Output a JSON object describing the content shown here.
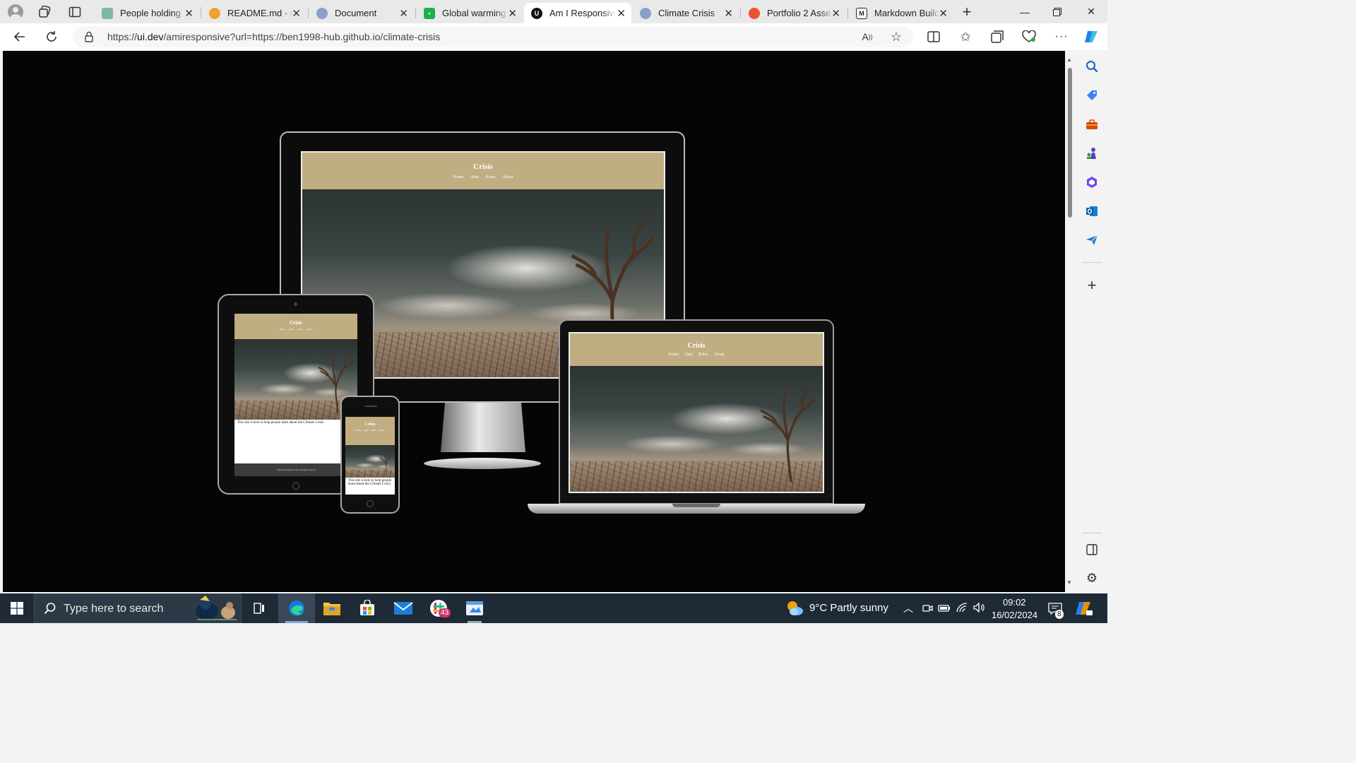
{
  "browser": {
    "tabs": [
      {
        "title": "People holding",
        "favicon_color": "#7fb7a3",
        "active": false
      },
      {
        "title": "README.md - c",
        "favicon_color": "#f0a030",
        "active": false
      },
      {
        "title": "Document",
        "favicon_color": "#8aa0c8",
        "active": false
      },
      {
        "title": "Global warming",
        "favicon_color": "#1fae4b",
        "active": false
      },
      {
        "title": "Am I Responsive",
        "favicon_color": "#111111",
        "active": true
      },
      {
        "title": "Climate Crisis",
        "favicon_color": "#8aa0c8",
        "active": false
      },
      {
        "title": "Portfolio 2 Asse",
        "favicon_color": "#e8542f",
        "active": false
      },
      {
        "title": "Markdown Builc",
        "favicon_color": "#222222",
        "active": false
      }
    ],
    "address": {
      "prefix": "https://",
      "domain": "ui.dev",
      "rest": "/amiresponsive?url=https://ben1998-hub.github.io/climate-crisis"
    }
  },
  "mockup": {
    "site_title": "Crisis",
    "nav": [
      "Home",
      "Quiz",
      "Rules",
      "About"
    ],
    "intro_text": "This site is here to help people learn about the Climate Crisis.",
    "phone_intro_text": "This site is here to help people learn about the Climate Crisis.",
    "footer_text": "©2024 The Climate Crisis. All rights reserved."
  },
  "taskbar": {
    "search_placeholder": "Type here to search",
    "weather": "9°C  Partly sunny",
    "time": "09:02",
    "date": "16/02/2024",
    "mail_badge": "43",
    "notification_badge": "8"
  },
  "colors": {
    "site_header": "#c0ad82",
    "page_bg": "#050505",
    "taskbar": "#1f2a37"
  }
}
